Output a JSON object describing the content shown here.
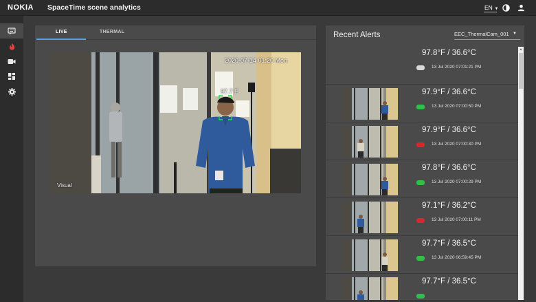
{
  "header": {
    "logo": "NOKIA",
    "title": "SpaceTime scene analytics",
    "language": "EN"
  },
  "sidebar": {
    "items": [
      {
        "icon": "message-icon",
        "active": true
      },
      {
        "icon": "fire-icon",
        "active": false,
        "color": "#e8403a"
      },
      {
        "icon": "video-camera-icon",
        "active": false
      },
      {
        "icon": "dashboard-icon",
        "active": false
      },
      {
        "icon": "gear-icon",
        "active": false
      }
    ]
  },
  "live_panel": {
    "tabs": [
      {
        "label": "LIVE",
        "active": true
      },
      {
        "label": "THERMAL",
        "active": false
      }
    ],
    "video": {
      "timestamp_overlay": "2020-07-14 01:20 Mon",
      "temperature_overlay": "97.7 F",
      "source_label": "Visual"
    }
  },
  "alerts": {
    "title": "Recent Alerts",
    "camera": "EEC_ThermalCam_001",
    "items": [
      {
        "temp": "97.8°F / 36.6°C",
        "timestamp": "13 Jul 2020 07:01:21 PM",
        "status": "unknown",
        "has_thumb": false
      },
      {
        "temp": "97.9°F / 36.6°C",
        "timestamp": "13 Jul 2020 07:00:50 PM",
        "status": "ok",
        "has_thumb": true
      },
      {
        "temp": "97.9°F / 36.6°C",
        "timestamp": "13 Jul 2020 07:00:30 PM",
        "status": "alert",
        "has_thumb": true
      },
      {
        "temp": "97.8°F / 36.6°C",
        "timestamp": "13 Jul 2020 07:00:29 PM",
        "status": "ok",
        "has_thumb": true
      },
      {
        "temp": "97.1°F / 36.2°C",
        "timestamp": "13 Jul 2020 07:00:11 PM",
        "status": "alert",
        "has_thumb": true
      },
      {
        "temp": "97.7°F / 36.5°C",
        "timestamp": "13 Jul 2020 06:59:45 PM",
        "status": "ok",
        "has_thumb": true
      },
      {
        "temp": "97.7°F / 36.5°C",
        "timestamp": "",
        "status": "ok",
        "has_thumb": true
      }
    ]
  },
  "colors": {
    "accent": "#5aa0e6",
    "ok": "#2fbf4a",
    "alert": "#d9262b",
    "unknown": "#d8d8d8"
  }
}
